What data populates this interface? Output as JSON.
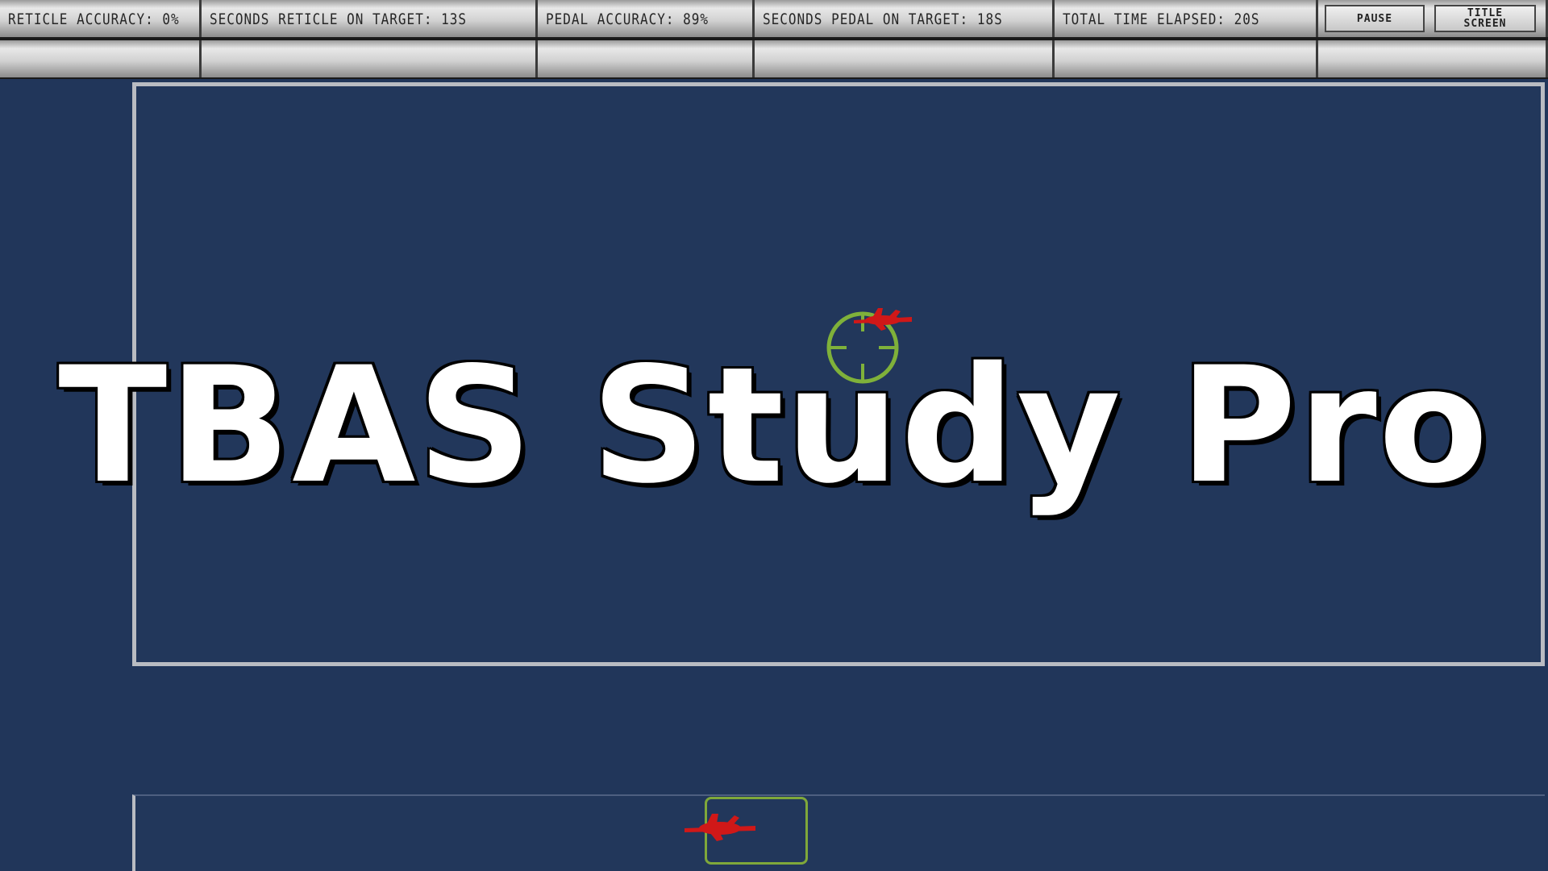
{
  "hud": {
    "reticle_accuracy": "RETICLE ACCURACY: 0%",
    "seconds_reticle_on_target": "SECONDS RETICLE ON TARGET: 13s",
    "pedal_accuracy": "PEDAL ACCURACY: 89%",
    "seconds_pedal_on_target": "SECONDS PEDAL ON TARGET: 18s",
    "total_time_elapsed": "TOTAL TIME ELAPSED: 20s",
    "pause_label": "PAUSE",
    "title_screen_label": "TITLE\nSCREEN"
  },
  "overlay": {
    "title": "TBAS Study Pro"
  },
  "colors": {
    "background": "#21365a",
    "field_border": "#b9bcc2",
    "reticle": "#7fb13a",
    "target": "#d01818"
  },
  "icons": {
    "reticle": "crosshair-reticle-icon",
    "target_top": "aircraft-target-icon",
    "target_bottom": "aircraft-target-icon"
  }
}
